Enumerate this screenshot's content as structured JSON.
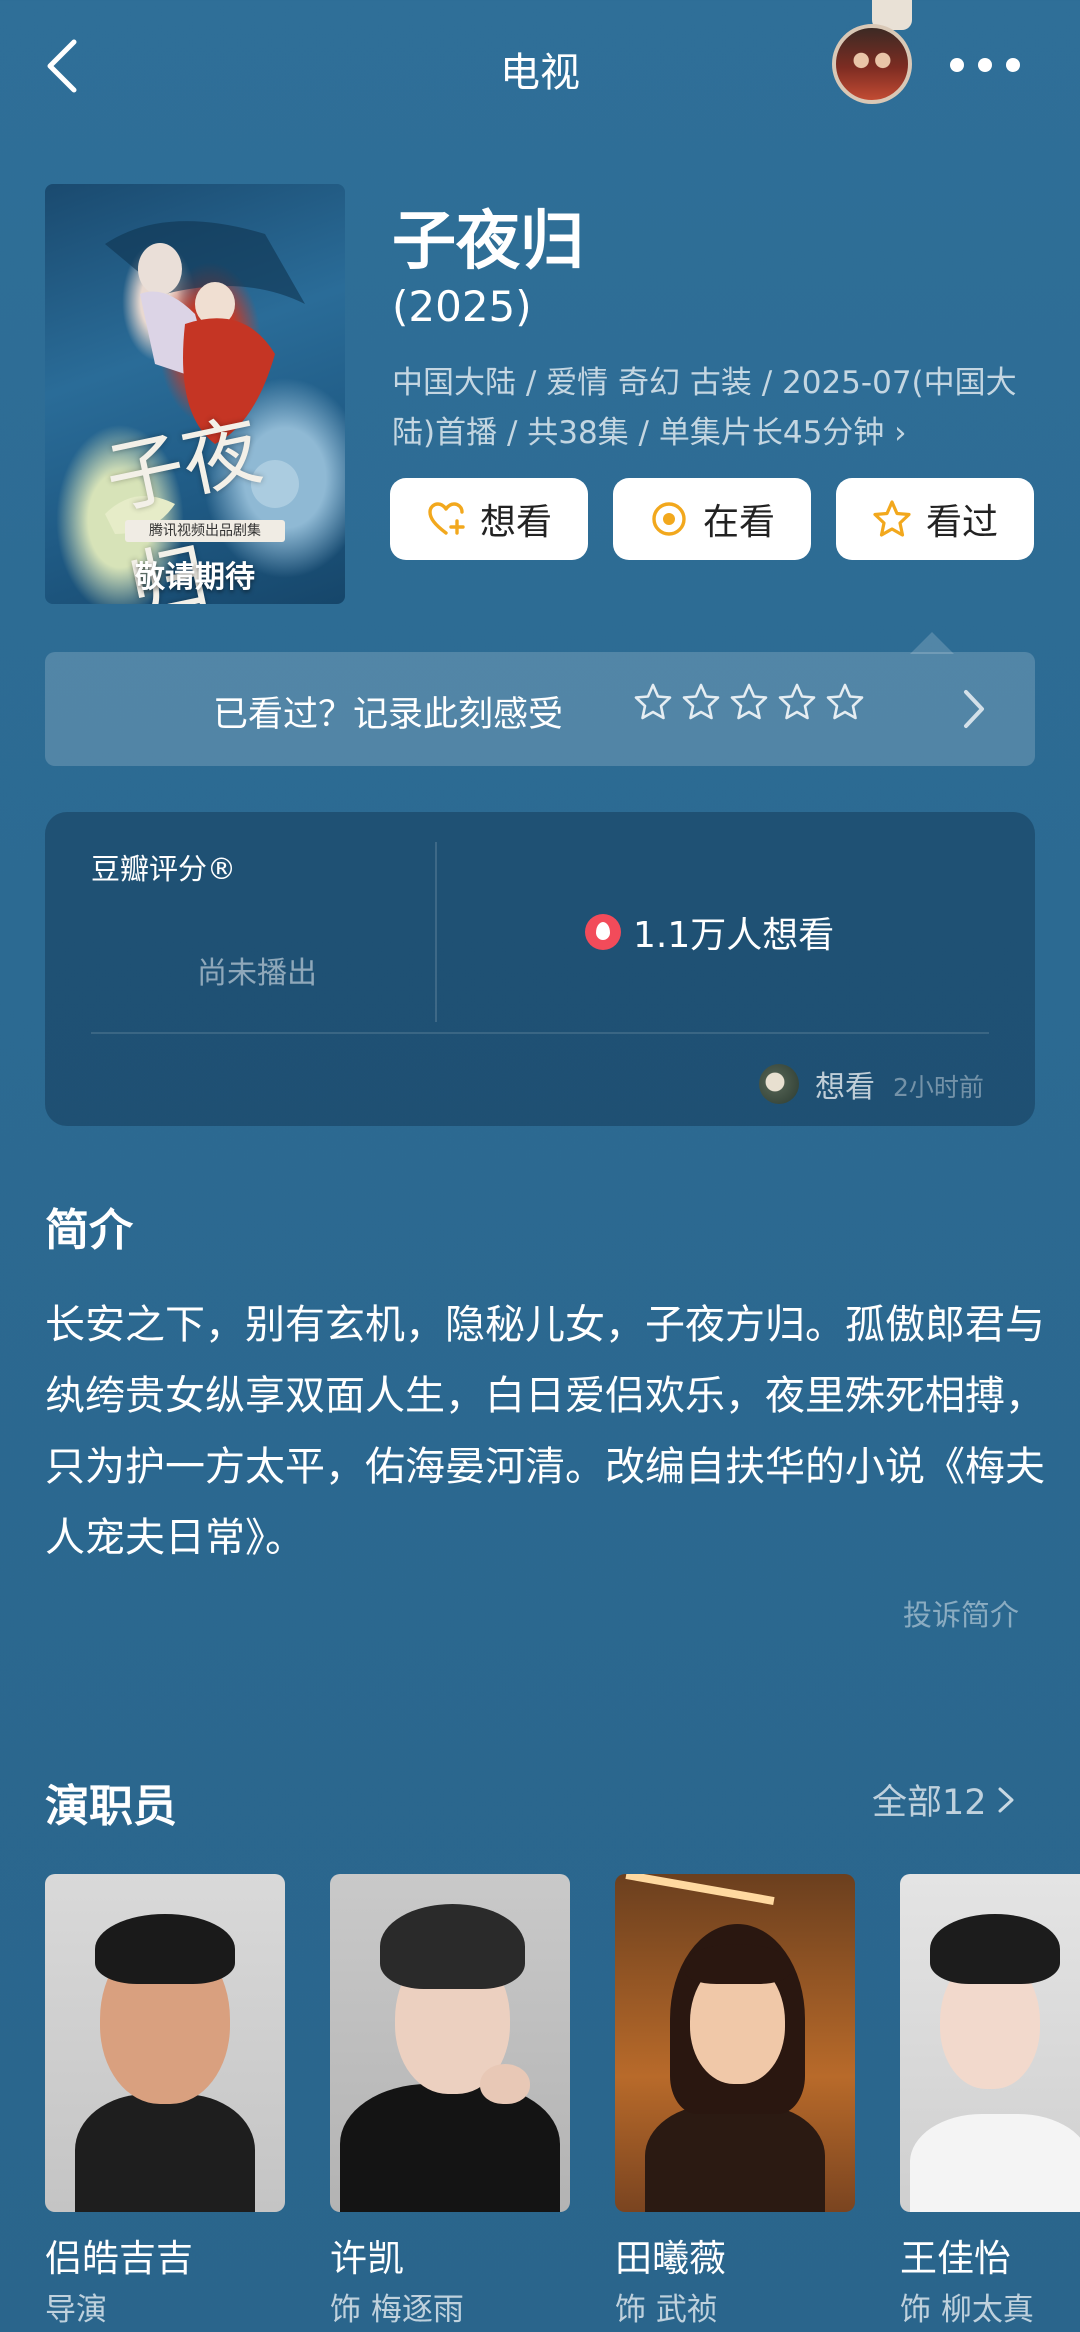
{
  "header": {
    "title": "电视"
  },
  "show": {
    "title": "子夜归",
    "year": "(2025)",
    "meta": "中国大陆 / 爱情 奇幻 古装 / 2025-07(中国大陆)首播 / 共38集 / 单集片长45分钟",
    "meta_arrow": "›",
    "poster_calligraphy": "子夜归",
    "poster_small_text": "腾讯视频出品剧集",
    "poster_caption": "敬请期待"
  },
  "actions": {
    "want": "想看",
    "watching": "在看",
    "watched": "看过"
  },
  "rate_prompt": {
    "text": "已看过？记录此刻感受",
    "star_count": 5
  },
  "rating": {
    "label": "豆瓣评分®",
    "status": "尚未播出",
    "hot_count": "1.1万人想看",
    "friend_action": "想看",
    "friend_time": "2小时前"
  },
  "synopsis": {
    "title": "简介",
    "text": "长安之下，别有玄机，隐秘儿女，子夜方归。孤傲郎君与纨绔贵女纵享双面人生，白日爱侣欢乐，夜里殊死相搏，只为护一方太平，佑海晏河清。改编自扶华的小说《梅夫人宠夫日常》。",
    "report": "投诉简介"
  },
  "cast": {
    "title": "演职员",
    "all_label": "全部12",
    "members": [
      {
        "name": "侣皓吉吉",
        "role": "导演"
      },
      {
        "name": "许凯",
        "role": "饰 梅逐雨"
      },
      {
        "name": "田曦薇",
        "role": "饰 武祯"
      },
      {
        "name": "王佳怡",
        "role": "饰 柳太真"
      }
    ]
  },
  "colors": {
    "background": "#2c6a92",
    "accent_orange": "#f2a81d",
    "hot_red": "#f24b5a"
  },
  "icons": {
    "back": "chevron-left-icon",
    "more": "more-dots-icon",
    "want": "heart-plus-icon",
    "watching": "target-circle-icon",
    "watched": "star-icon"
  }
}
